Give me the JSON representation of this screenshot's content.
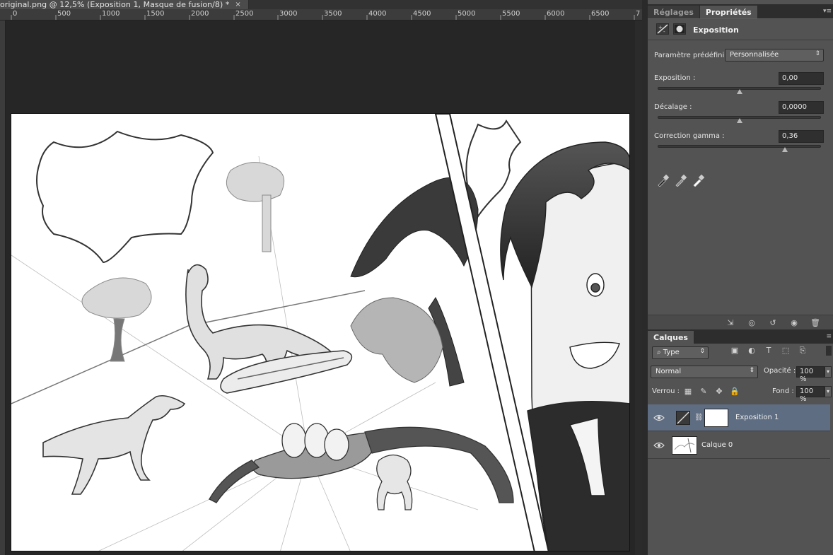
{
  "document": {
    "tab_title": "original.png @ 12,5% (Exposition 1, Masque de fusion/8) *",
    "close_glyph": "×",
    "ruler_labels": [
      "0",
      "500",
      "1000",
      "1500",
      "2000",
      "2500",
      "3000",
      "3500",
      "4000",
      "4500",
      "5000",
      "5500",
      "6000",
      "6500",
      "7"
    ]
  },
  "properties_panel": {
    "tabs": [
      "Réglages",
      "Propriétés"
    ],
    "active_tab": "Propriétés",
    "title": "Exposition",
    "preset_label": "Paramètre prédéfini :",
    "preset_value": "Personnalisée",
    "exposure_label": "Exposition :",
    "exposure_value": "0,00",
    "offset_label": "Décalage :",
    "offset_value": "0,0000",
    "gamma_label": "Correction gamma :",
    "gamma_value": "0,36",
    "slider_levels": {
      "exposure": 0.5,
      "offset": 0.5,
      "gamma": 0.78
    }
  },
  "layers_panel": {
    "tab": "Calques",
    "filter_type": "Type",
    "blend_mode": "Normal",
    "opacity_label": "Opacité :",
    "opacity_value": "100 %",
    "lock_label": "Verrou :",
    "fill_label": "Fond :",
    "fill_value": "100 %",
    "layers": [
      {
        "name": "Exposition 1",
        "selected": true
      },
      {
        "name": "Calque 0",
        "selected": false
      }
    ]
  },
  "colors": {
    "panel_bg": "#535353",
    "selected_layer": "#5f6d82",
    "workspace": "#262626"
  }
}
